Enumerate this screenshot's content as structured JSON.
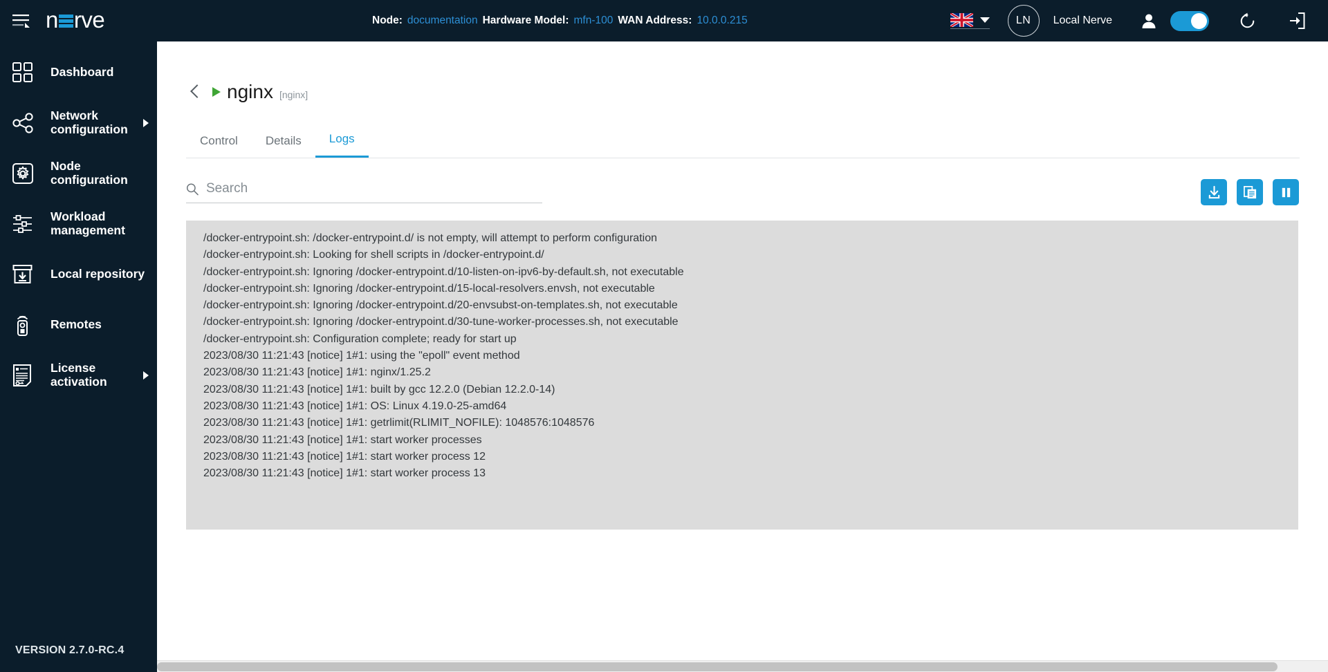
{
  "app": {
    "brand_prefix": "n",
    "brand_suffix": "rve",
    "version": "VERSION 2.7.0-RC.4",
    "accent_color": "#1b9ad6",
    "dark_color": "#0b1d2b"
  },
  "topbar": {
    "node_label": "Node:",
    "node_value": "documentation",
    "hardware_label": "Hardware Model:",
    "hardware_value": "mfn-100",
    "wan_label": "WAN Address:",
    "wan_value": "10.0.0.215",
    "language_flag": "uk-flag-icon",
    "avatar_initials": "LN",
    "organization": "Local Nerve",
    "menu_icon": "hamburger-menu-icon",
    "user_icon": "user-icon",
    "toggle_state": "on",
    "refresh_icon": "refresh-icon",
    "logout_icon": "logout-icon"
  },
  "sidebar": {
    "items": [
      {
        "label": "Dashboard",
        "icon": "dashboard-grid-icon",
        "has_submenu": false
      },
      {
        "label": "Network\nconfiguration",
        "icon": "network-share-icon",
        "has_submenu": true
      },
      {
        "label": "Node\nconfiguration",
        "icon": "gear-square-icon",
        "has_submenu": false
      },
      {
        "label": "Workload\nmanagement",
        "icon": "sliders-icon",
        "has_submenu": false
      },
      {
        "label": "Local repository",
        "icon": "archive-download-icon",
        "has_submenu": false
      },
      {
        "label": "Remotes",
        "icon": "remote-control-icon",
        "has_submenu": false
      },
      {
        "label": "License\nactivation",
        "icon": "license-document-icon",
        "has_submenu": true
      }
    ]
  },
  "page": {
    "back_icon": "back-chevron-icon",
    "status_icon": "running-play-icon",
    "title": "nginx",
    "subtitle": "[nginx]",
    "tabs": [
      {
        "label": "Control",
        "active": false
      },
      {
        "label": "Details",
        "active": false
      },
      {
        "label": "Logs",
        "active": true
      }
    ]
  },
  "toolbar": {
    "search_placeholder": "Search",
    "search_value": "",
    "search_icon": "search-icon",
    "buttons": [
      {
        "name": "download-button",
        "icon": "download-icon"
      },
      {
        "name": "copy-button",
        "icon": "copy-icon"
      },
      {
        "name": "pause-button",
        "icon": "pause-icon"
      }
    ]
  },
  "logs": {
    "lines": [
      "/docker-entrypoint.sh: /docker-entrypoint.d/ is not empty, will attempt to perform configuration",
      "/docker-entrypoint.sh: Looking for shell scripts in /docker-entrypoint.d/",
      "/docker-entrypoint.sh: Ignoring /docker-entrypoint.d/10-listen-on-ipv6-by-default.sh, not executable",
      "/docker-entrypoint.sh: Ignoring /docker-entrypoint.d/15-local-resolvers.envsh, not executable",
      "/docker-entrypoint.sh: Ignoring /docker-entrypoint.d/20-envsubst-on-templates.sh, not executable",
      "/docker-entrypoint.sh: Ignoring /docker-entrypoint.d/30-tune-worker-processes.sh, not executable",
      "/docker-entrypoint.sh: Configuration complete; ready for start up",
      "2023/08/30 11:21:43 [notice] 1#1: using the \"epoll\" event method",
      "2023/08/30 11:21:43 [notice] 1#1: nginx/1.25.2",
      "2023/08/30 11:21:43 [notice] 1#1: built by gcc 12.2.0 (Debian 12.2.0-14)",
      "2023/08/30 11:21:43 [notice] 1#1: OS: Linux 4.19.0-25-amd64",
      "2023/08/30 11:21:43 [notice] 1#1: getrlimit(RLIMIT_NOFILE): 1048576:1048576",
      "2023/08/30 11:21:43 [notice] 1#1: start worker processes",
      "2023/08/30 11:21:43 [notice] 1#1: start worker process 12",
      "2023/08/30 11:21:43 [notice] 1#1: start worker process 13"
    ]
  }
}
